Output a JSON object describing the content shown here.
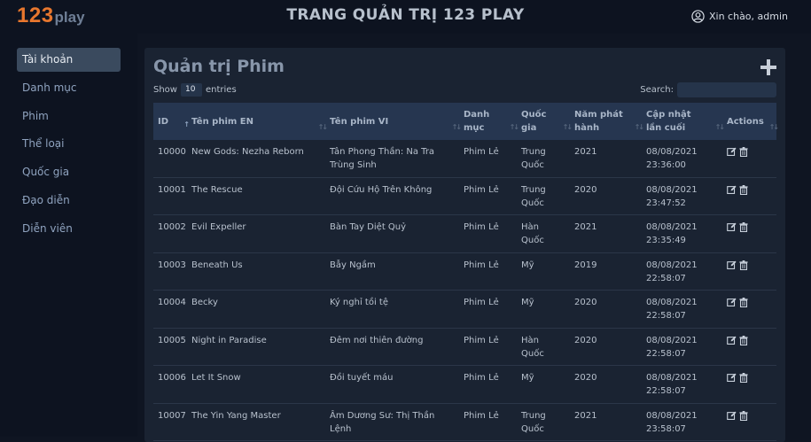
{
  "header": {
    "logo_number": "123",
    "logo_text": "play",
    "title": "TRANG QUẢN TRỊ 123 PLAY",
    "user_greeting": "Xin chào, admin"
  },
  "sidebar": {
    "items": [
      {
        "label": "Tài khoản"
      },
      {
        "label": "Danh mục"
      },
      {
        "label": "Phim"
      },
      {
        "label": "Thể loại"
      },
      {
        "label": "Quốc gia"
      },
      {
        "label": "Đạo diễn"
      },
      {
        "label": "Diễn viên"
      }
    ]
  },
  "main": {
    "title": "Quản trị Phim",
    "show_label": "Show",
    "page_length": "10",
    "entries_label": "entries",
    "search_label": "Search:",
    "search_value": ""
  },
  "table": {
    "columns": [
      "ID",
      "Tên phim EN",
      "Tên phim VI",
      "Danh mục",
      "Quốc gia",
      "Năm phát hành",
      "Cập nhật lần cuối",
      "Actions"
    ],
    "rows": [
      {
        "id": "10000",
        "en": "New Gods: Nezha Reborn",
        "vi": "Tân Phong Thần: Na Tra Trùng Sinh",
        "cat": "Phim Lẻ",
        "country": "Trung Quốc",
        "year": "2021",
        "updated": "08/08/2021 23:36:00"
      },
      {
        "id": "10001",
        "en": "The Rescue",
        "vi": "Đội Cứu Hộ Trên Không",
        "cat": "Phim Lẻ",
        "country": "Trung Quốc",
        "year": "2020",
        "updated": "08/08/2021 23:47:52"
      },
      {
        "id": "10002",
        "en": "Evil Expeller",
        "vi": "Bàn Tay Diệt Quỷ",
        "cat": "Phim Lẻ",
        "country": "Hàn Quốc",
        "year": "2021",
        "updated": "08/08/2021 23:35:49"
      },
      {
        "id": "10003",
        "en": "Beneath Us",
        "vi": "Bẫy Ngầm",
        "cat": "Phim Lẻ",
        "country": "Mỹ",
        "year": "2019",
        "updated": "08/08/2021 22:58:07"
      },
      {
        "id": "10004",
        "en": "Becky",
        "vi": "Ký nghỉ tồi tệ",
        "cat": "Phim Lẻ",
        "country": "Mỹ",
        "year": "2020",
        "updated": "08/08/2021 22:58:07"
      },
      {
        "id": "10005",
        "en": "Night in Paradise",
        "vi": "Đêm nơi thiên đường",
        "cat": "Phim Lẻ",
        "country": "Hàn Quốc",
        "year": "2020",
        "updated": "08/08/2021 22:58:07"
      },
      {
        "id": "10006",
        "en": "Let It Snow",
        "vi": "Đồi tuyết máu",
        "cat": "Phim Lẻ",
        "country": "Mỹ",
        "year": "2020",
        "updated": "08/08/2021 22:58:07"
      },
      {
        "id": "10007",
        "en": "The Yin Yang Master",
        "vi": "Âm Dương Sư: Thị Thần Lệnh",
        "cat": "Phim Lẻ",
        "country": "Trung Quốc",
        "year": "2021",
        "updated": "08/08/2021 23:58:07"
      }
    ]
  },
  "icons": {
    "user": "user-circle-icon",
    "add": "plus-icon",
    "edit": "edit-icon",
    "delete": "trash-icon",
    "sort": "sort-arrows-icon"
  },
  "colors": {
    "accent": "#e8772e",
    "background": "#0f1522",
    "card": "#1a2332",
    "table_header": "#263650",
    "active_nav": "#3a4a5e"
  }
}
